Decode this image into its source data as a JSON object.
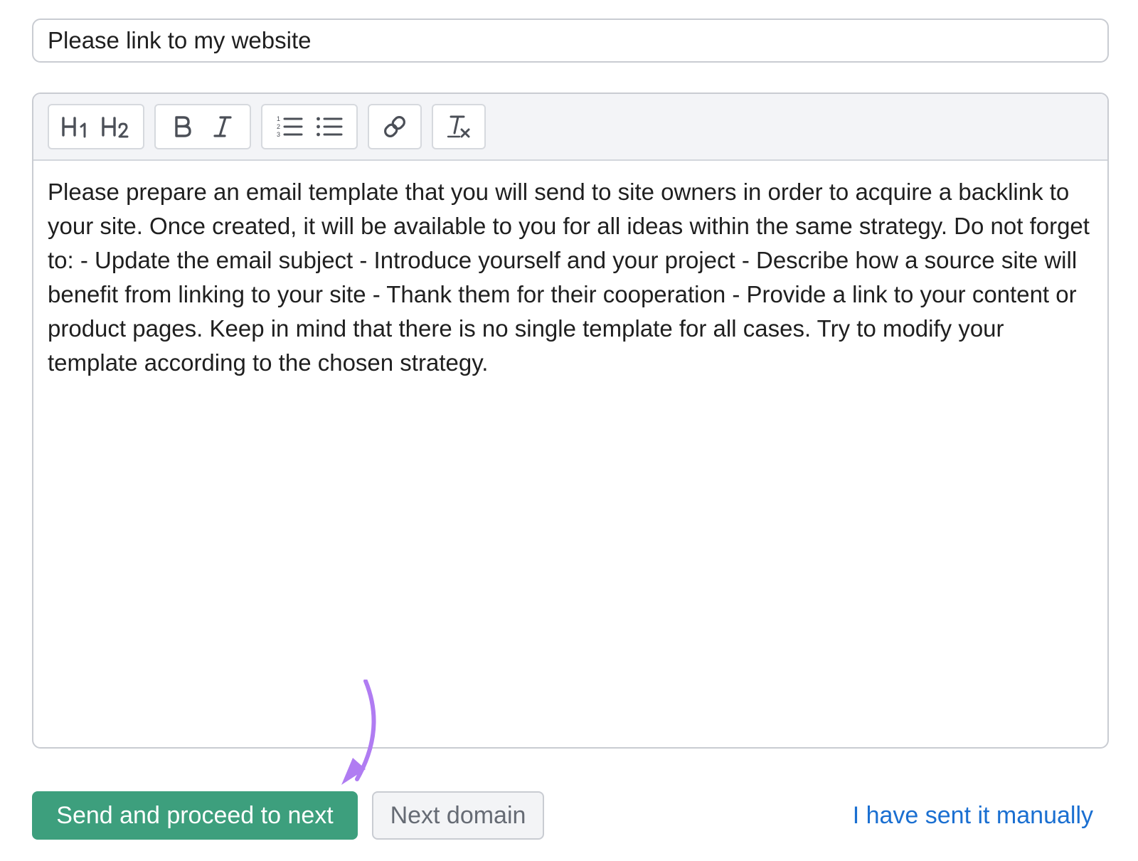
{
  "subject": {
    "value": "Please link to my website"
  },
  "toolbar": {
    "buttons": [
      "heading-1-icon",
      "heading-2-icon",
      "bold-icon",
      "italic-icon",
      "ordered-list-icon",
      "bullet-list-icon",
      "link-icon",
      "clear-format-icon"
    ]
  },
  "editor": {
    "body": "Please prepare an email template that you will send to site owners in order to acquire a backlink to your site. Once created, it will be available to you for all ideas within the same strategy. Do not forget to: - Update the email subject - Introduce yourself and your project - Describe how a source site will benefit from linking to your site - Thank them for their cooperation - Provide a link to your content or product pages. Keep in mind that there is no single template for all cases. Try to modify your template according to the chosen strategy."
  },
  "actions": {
    "send_label": "Send and proceed to next",
    "next_label": "Next domain",
    "manual_label": "I have sent it manually"
  },
  "colors": {
    "primary": "#3d9f7d",
    "link": "#1a6fd1",
    "annotation_arrow": "#b07cf2"
  }
}
